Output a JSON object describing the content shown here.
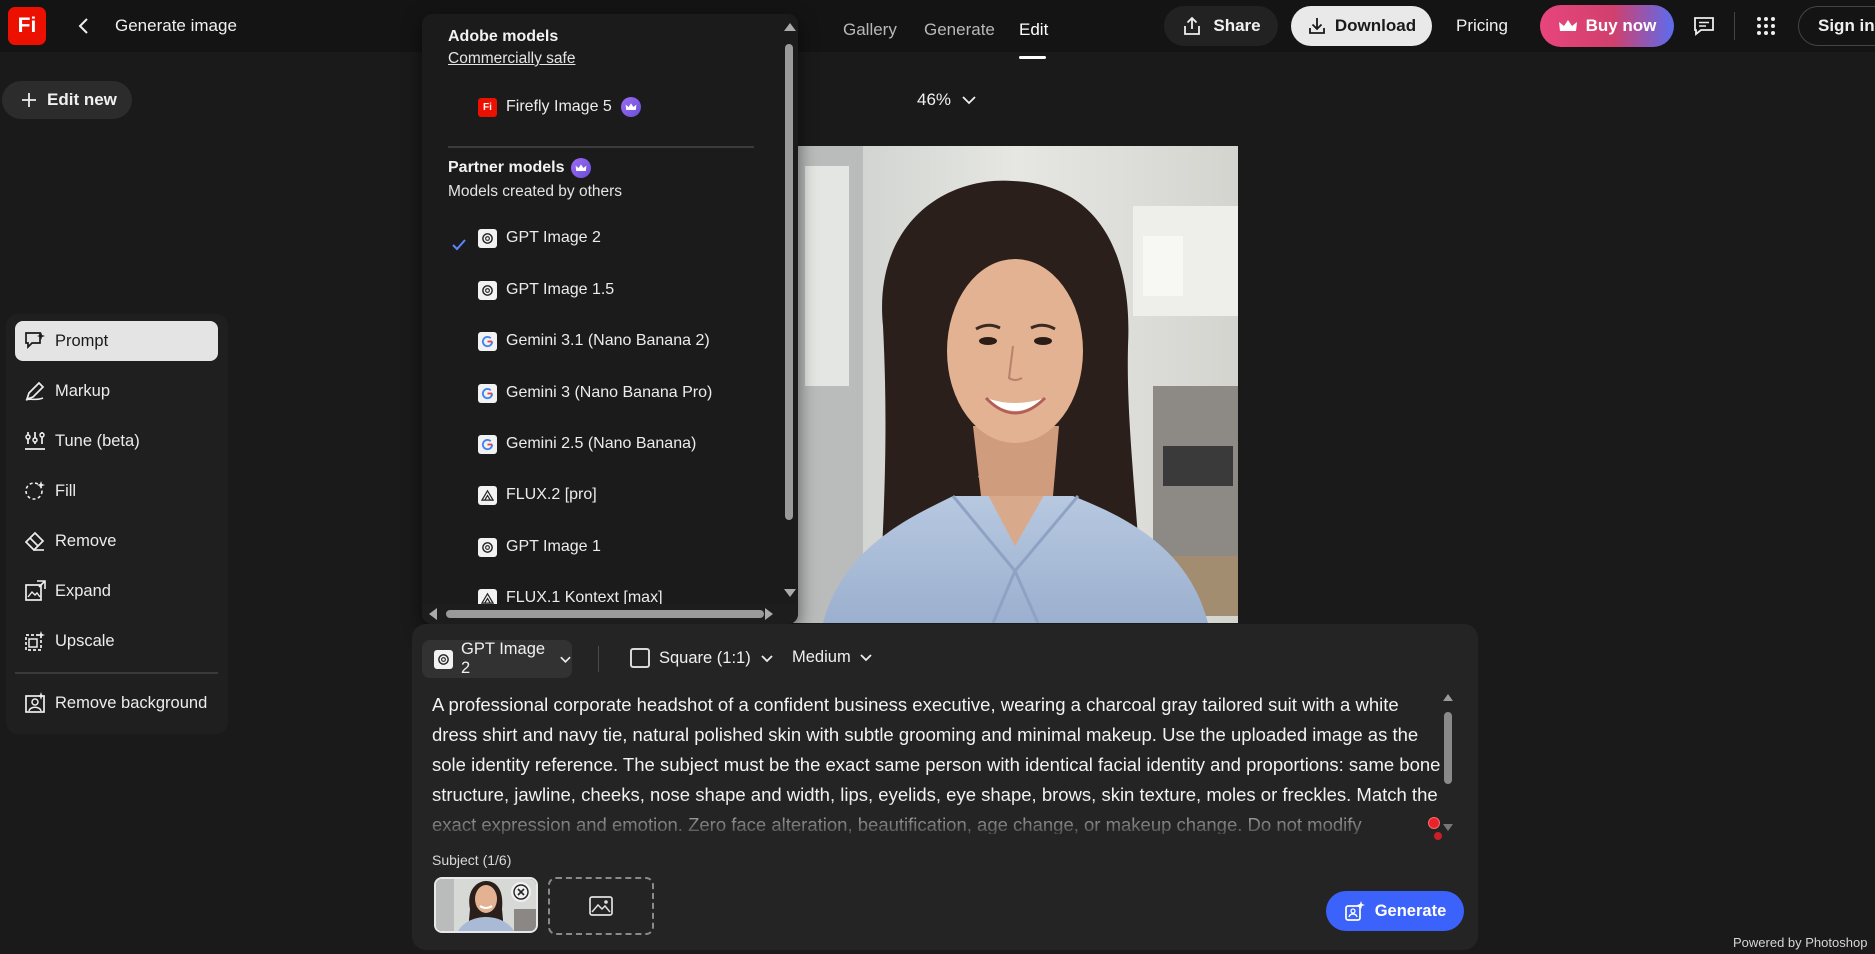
{
  "app": {
    "logo_text": "Fi",
    "title": "Generate image"
  },
  "nav": {
    "tabs": [
      {
        "label": "Gallery",
        "active": false
      },
      {
        "label": "Generate",
        "active": false
      },
      {
        "label": "Edit",
        "active": true
      }
    ]
  },
  "header": {
    "share_label": "Share",
    "download_label": "Download",
    "pricing_label": "Pricing",
    "buy_label": "Buy now",
    "signin_label": "Sign in"
  },
  "sidebar": {
    "edit_new_label": "Edit new",
    "tools": [
      {
        "label": "Prompt",
        "icon": "prompt-icon",
        "active": true
      },
      {
        "label": "Markup",
        "icon": "markup-icon",
        "active": false
      },
      {
        "label": "Tune (beta)",
        "icon": "tune-icon",
        "active": false
      },
      {
        "label": "Fill",
        "icon": "fill-icon",
        "active": false
      },
      {
        "label": "Remove",
        "icon": "remove-icon",
        "active": false
      },
      {
        "label": "Expand",
        "icon": "expand-icon",
        "active": false
      },
      {
        "label": "Upscale",
        "icon": "upscale-icon",
        "active": false
      },
      {
        "label": "Remove background",
        "icon": "remove-background-icon",
        "active": false
      }
    ]
  },
  "canvas": {
    "zoom": "46%"
  },
  "model_menu": {
    "adobe_heading": "Adobe models",
    "adobe_sub": "Commercially safe",
    "partner_heading": "Partner models",
    "partner_sub": "Models created by others",
    "adobe_items": [
      {
        "label": "Firefly Image 5",
        "icon": "firefly-icon",
        "premium": true
      }
    ],
    "partner_items": [
      {
        "label": "GPT Image 2",
        "icon": "openai-icon",
        "selected": true
      },
      {
        "label": "GPT Image 1.5",
        "icon": "openai-icon",
        "selected": false
      },
      {
        "label": "Gemini 3.1 (Nano Banana 2)",
        "icon": "google-icon",
        "selected": false
      },
      {
        "label": "Gemini 3 (Nano Banana Pro)",
        "icon": "google-icon",
        "selected": false
      },
      {
        "label": "Gemini 2.5 (Nano Banana)",
        "icon": "google-icon",
        "selected": false
      },
      {
        "label": "FLUX.2 [pro]",
        "icon": "flux-icon",
        "selected": false
      },
      {
        "label": "GPT Image 1",
        "icon": "openai-icon",
        "selected": false
      },
      {
        "label": "FLUX.1 Kontext [max]",
        "icon": "flux-icon",
        "selected": false
      }
    ]
  },
  "prompt_panel": {
    "model_label": "GPT Image 2",
    "aspect_label": "Square (1:1)",
    "quality_label": "Medium",
    "prompt_text": "A professional corporate headshot of a confident business executive, wearing a charcoal gray tailored suit with a white dress shirt and navy tie, natural polished skin with subtle grooming and minimal makeup. Use the uploaded image as the sole identity reference. The subject must be the exact same person with identical facial identity and proportions: same bone structure, jawline, cheeks, nose shape and width, lips, eyelids, eye shape, brows, skin texture, moles or freckles. Match the exact expression and emotion. Zero face alteration, beautification, age change, or makeup change. Do not modify",
    "subject_label": "Subject (1/6)",
    "generate_label": "Generate"
  },
  "footer": {
    "powered_by": "Powered by Photoshop"
  },
  "colors": {
    "accent_blue": "#3b63fb",
    "logo_red": "#eb1000",
    "buy_gradient_start": "#e8457c",
    "buy_gradient_end": "#5b6cf0",
    "premium_purple": "#8a5cf0"
  }
}
